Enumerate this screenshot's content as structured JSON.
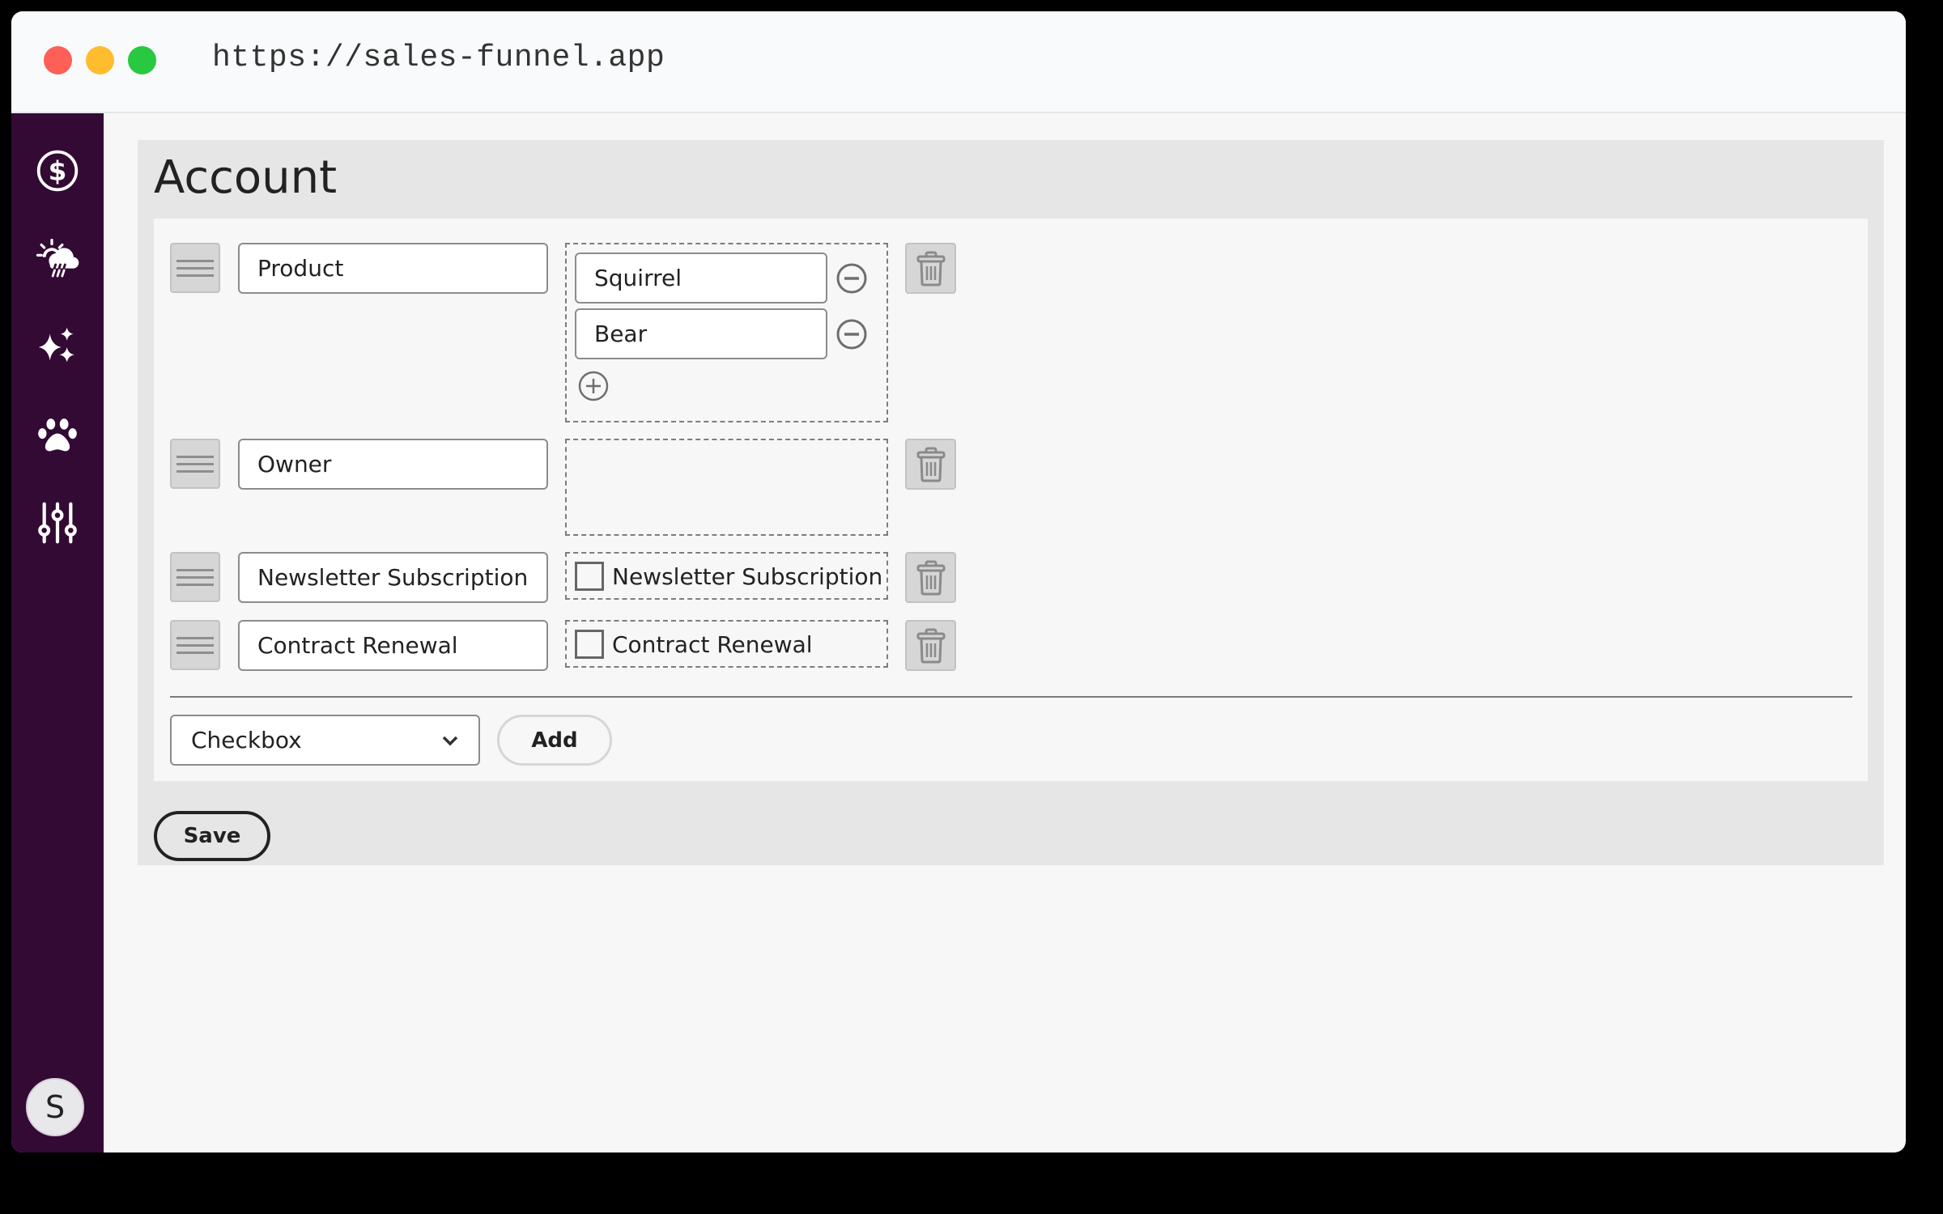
{
  "browser": {
    "url": "https://sales-funnel.app"
  },
  "sidebar": {
    "items": [
      {
        "icon": "dollar-circle-icon"
      },
      {
        "icon": "weather-sun-rain-icon"
      },
      {
        "icon": "sparkles-icon"
      },
      {
        "icon": "paw-icon"
      },
      {
        "icon": "sliders-icon"
      }
    ],
    "avatar_initial": "S"
  },
  "page": {
    "title": "Account"
  },
  "fields": [
    {
      "name": "Product",
      "type": "select-options",
      "options": [
        "Squirrel",
        "Bear"
      ]
    },
    {
      "name": "Owner",
      "type": "empty",
      "options": []
    },
    {
      "name": "Newsletter Subscription",
      "type": "checkbox",
      "checkbox_label": "Newsletter Subscription",
      "checked": false
    },
    {
      "name": "Contract Renewal",
      "type": "checkbox",
      "checkbox_label": "Contract Renewal",
      "checked": false
    }
  ],
  "add_field": {
    "selected_type": "Checkbox",
    "add_label": "Add"
  },
  "actions": {
    "save_label": "Save"
  }
}
